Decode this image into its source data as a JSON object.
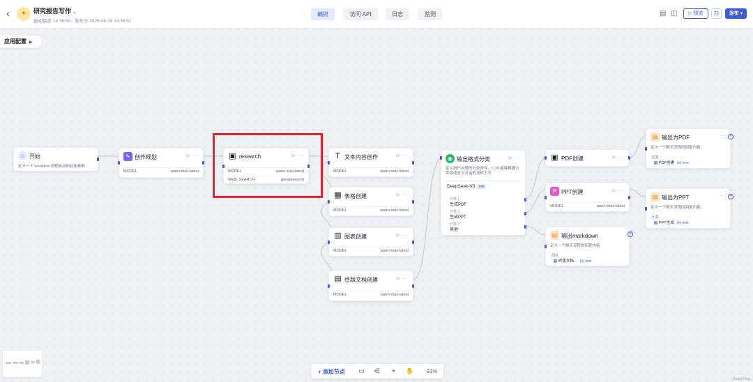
{
  "header": {
    "back_icon": "chevron-left-icon",
    "app_icon": "lightbulb-icon",
    "title": "研究报告写作",
    "meta": "自动保存 14:36:50 · 发布于 2025-06-26 14:36:51",
    "tabs": [
      {
        "label": "编排",
        "active": true
      },
      {
        "label": "访问 API",
        "active": false
      },
      {
        "label": "日志",
        "active": false
      },
      {
        "label": "监测",
        "active": false
      }
    ],
    "preview_label": "预览",
    "publish_label": "发布"
  },
  "app_config_label": "应用配置",
  "colors": {
    "accent": "#3b5bdb",
    "highlight": "#e4222a",
    "llm_icon": "#7b61ff",
    "classifier_icon": "#1fb86b",
    "ppt_icon": "#e055c7",
    "output_icon": "#f08c2a"
  },
  "nodes": {
    "start": {
      "title": "开始",
      "desc": "定义一个 workflow 流程启动的初始参数"
    },
    "planning": {
      "title": "创作规划",
      "model_key": "MODEL",
      "model_val": "qwen-max-latest"
    },
    "research": {
      "title": "research",
      "model_key": "MODEL",
      "model_val": "qwen-max-latest",
      "search_key": "WEB_SEARCH",
      "search_val": "googlesearch"
    },
    "text_create": {
      "title": "文本内容创作",
      "model_key": "MODEL",
      "model_val": "qwen-max-latest"
    },
    "table_create": {
      "title": "表格创建",
      "model_key": "MODEL",
      "model_val": "qwen-max-latest"
    },
    "chart_create": {
      "title": "图表创建",
      "model_key": "MODEL",
      "model_val": "qwen-max-latest"
    },
    "final_doc": {
      "title": "终版文档创建",
      "model_key": "MODEL",
      "model_val": "qwen-max-latest"
    },
    "classifier": {
      "title": "输出格式分类",
      "desc1": "定义用户问题的分类条件，LLM 能够根据分",
      "desc2": "类描述定义对话的流转方式",
      "model": "DeepSeek-V3",
      "model_badge": "64K",
      "classes": [
        {
          "label": "分类 1",
          "value": "生成PDF"
        },
        {
          "label": "分类 2",
          "value": "生成PPT"
        },
        {
          "label": "分类 3",
          "value": "其他"
        }
      ]
    },
    "pdf_create": {
      "title": "PDF创建"
    },
    "ppt_create": {
      "title": "PPT创建",
      "model_key": "MODEL",
      "model_val": "qwen-max-latest"
    },
    "out_pdf": {
      "title": "输出为PDF",
      "desc": "定义一个聊天流程的回复内容",
      "out_label": "回复",
      "out_var": "PDF创建",
      "out_type": "{x} text"
    },
    "out_ppt": {
      "title": "输出为PPT",
      "desc": "定义一个聊天流程的回复内容",
      "out_label": "回复",
      "out_var": "PPT生成",
      "out_type": "{x} text"
    },
    "out_md": {
      "title": "输出markdown",
      "desc": "定义一个聊天流程的回复内容",
      "out_label": "回复",
      "out_var": "终版文档...",
      "out_type": "{x} text"
    }
  },
  "toolbar": {
    "add_node_label": "+ 添加节点",
    "zoom": "81%"
  },
  "footer_note": "React Flow"
}
